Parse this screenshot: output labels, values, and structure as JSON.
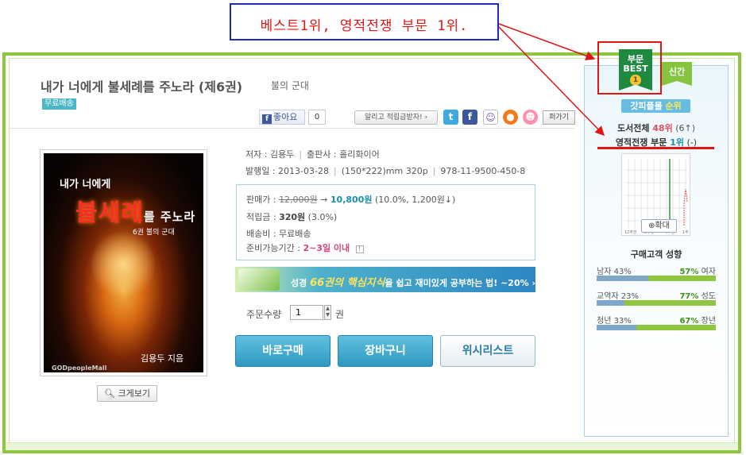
{
  "annotation": {
    "callout_text": "베스트1위, 영적전쟁 부문 1위."
  },
  "product": {
    "title": "내가 너에게 불세례를 주노라 (제6권)",
    "subtitle": "불의 군대",
    "free_shipping_badge": "무료배송",
    "author_label": "저자 : 김용두",
    "publisher_label": "출판사 : 홀리화이어",
    "publish_date": "발행일 : 2013-03-28",
    "size": "(150*222)mm 320p",
    "isbn": "978-11-9500-450-8",
    "cover": {
      "line1": "내가 너에게",
      "line2_big": "불세례",
      "line2_small": "를 주노라",
      "sub": "6권 불의 군대",
      "author": "김용두 지음",
      "mall": "GODpeopleMall"
    },
    "zoom_button": "크게보기"
  },
  "social": {
    "like_label": "좋아요",
    "like_count": "0",
    "share_label": "알리고 적립금받자! ›",
    "paste_label": "퍼가기"
  },
  "price": {
    "label_price": "판매가 :",
    "original": "12,000원",
    "arrow": "→",
    "sale": "10,800원",
    "discount": "(10.0%, 1,200원↓)",
    "points_label": "적립금 :",
    "points": "320원",
    "points_rate": "(3.0%)",
    "shipping_label": "배송비 : 무료배송",
    "prep_label": "준비가능기간 :",
    "prep_value": "2~3일 이내"
  },
  "banner": {
    "pre": "성경 ",
    "highlight": "66권의 핵심지식",
    "post": "을 쉽고 재미있게 공부하는 법! ~20% ›"
  },
  "order": {
    "qty_label": "주문수량",
    "qty_value": "1",
    "qty_unit": "권",
    "buy": "바로구매",
    "cart": "장바구니",
    "wish": "위시리스트"
  },
  "ranking": {
    "tab_best_top": "부문",
    "tab_best_bottom": "BEST",
    "tab_best_medal": "1",
    "tab_new": "신간",
    "label_pre": "갓피플몰 ",
    "label_hl": "순위",
    "overall_pre": "도서전체 ",
    "overall_rank": "48위",
    "overall_delta": " (6↑)",
    "category_pre": "영적전쟁 부문 ",
    "category_rank": "1위",
    "category_delta": " (-)",
    "chart_zoom": "확대",
    "chart_ticks": [
      "12주전",
      "8주전",
      "4주전",
      "1주"
    ],
    "colors": {
      "accent": "#8ec63f",
      "brand_blue": "#2f98c2",
      "annotation": "#e01616"
    }
  },
  "demographics": {
    "title": "구매고객 성향",
    "rows": [
      {
        "left": "남자 43%",
        "right_value": "57%",
        "right_label": " 여자",
        "left_fraction": 0.43
      },
      {
        "left": "교역자 23%",
        "right_value": "77%",
        "right_label": " 성도",
        "left_fraction": 0.23
      },
      {
        "left": "청년 33%",
        "right_value": "67%",
        "right_label": " 장년",
        "left_fraction": 0.33
      }
    ]
  }
}
